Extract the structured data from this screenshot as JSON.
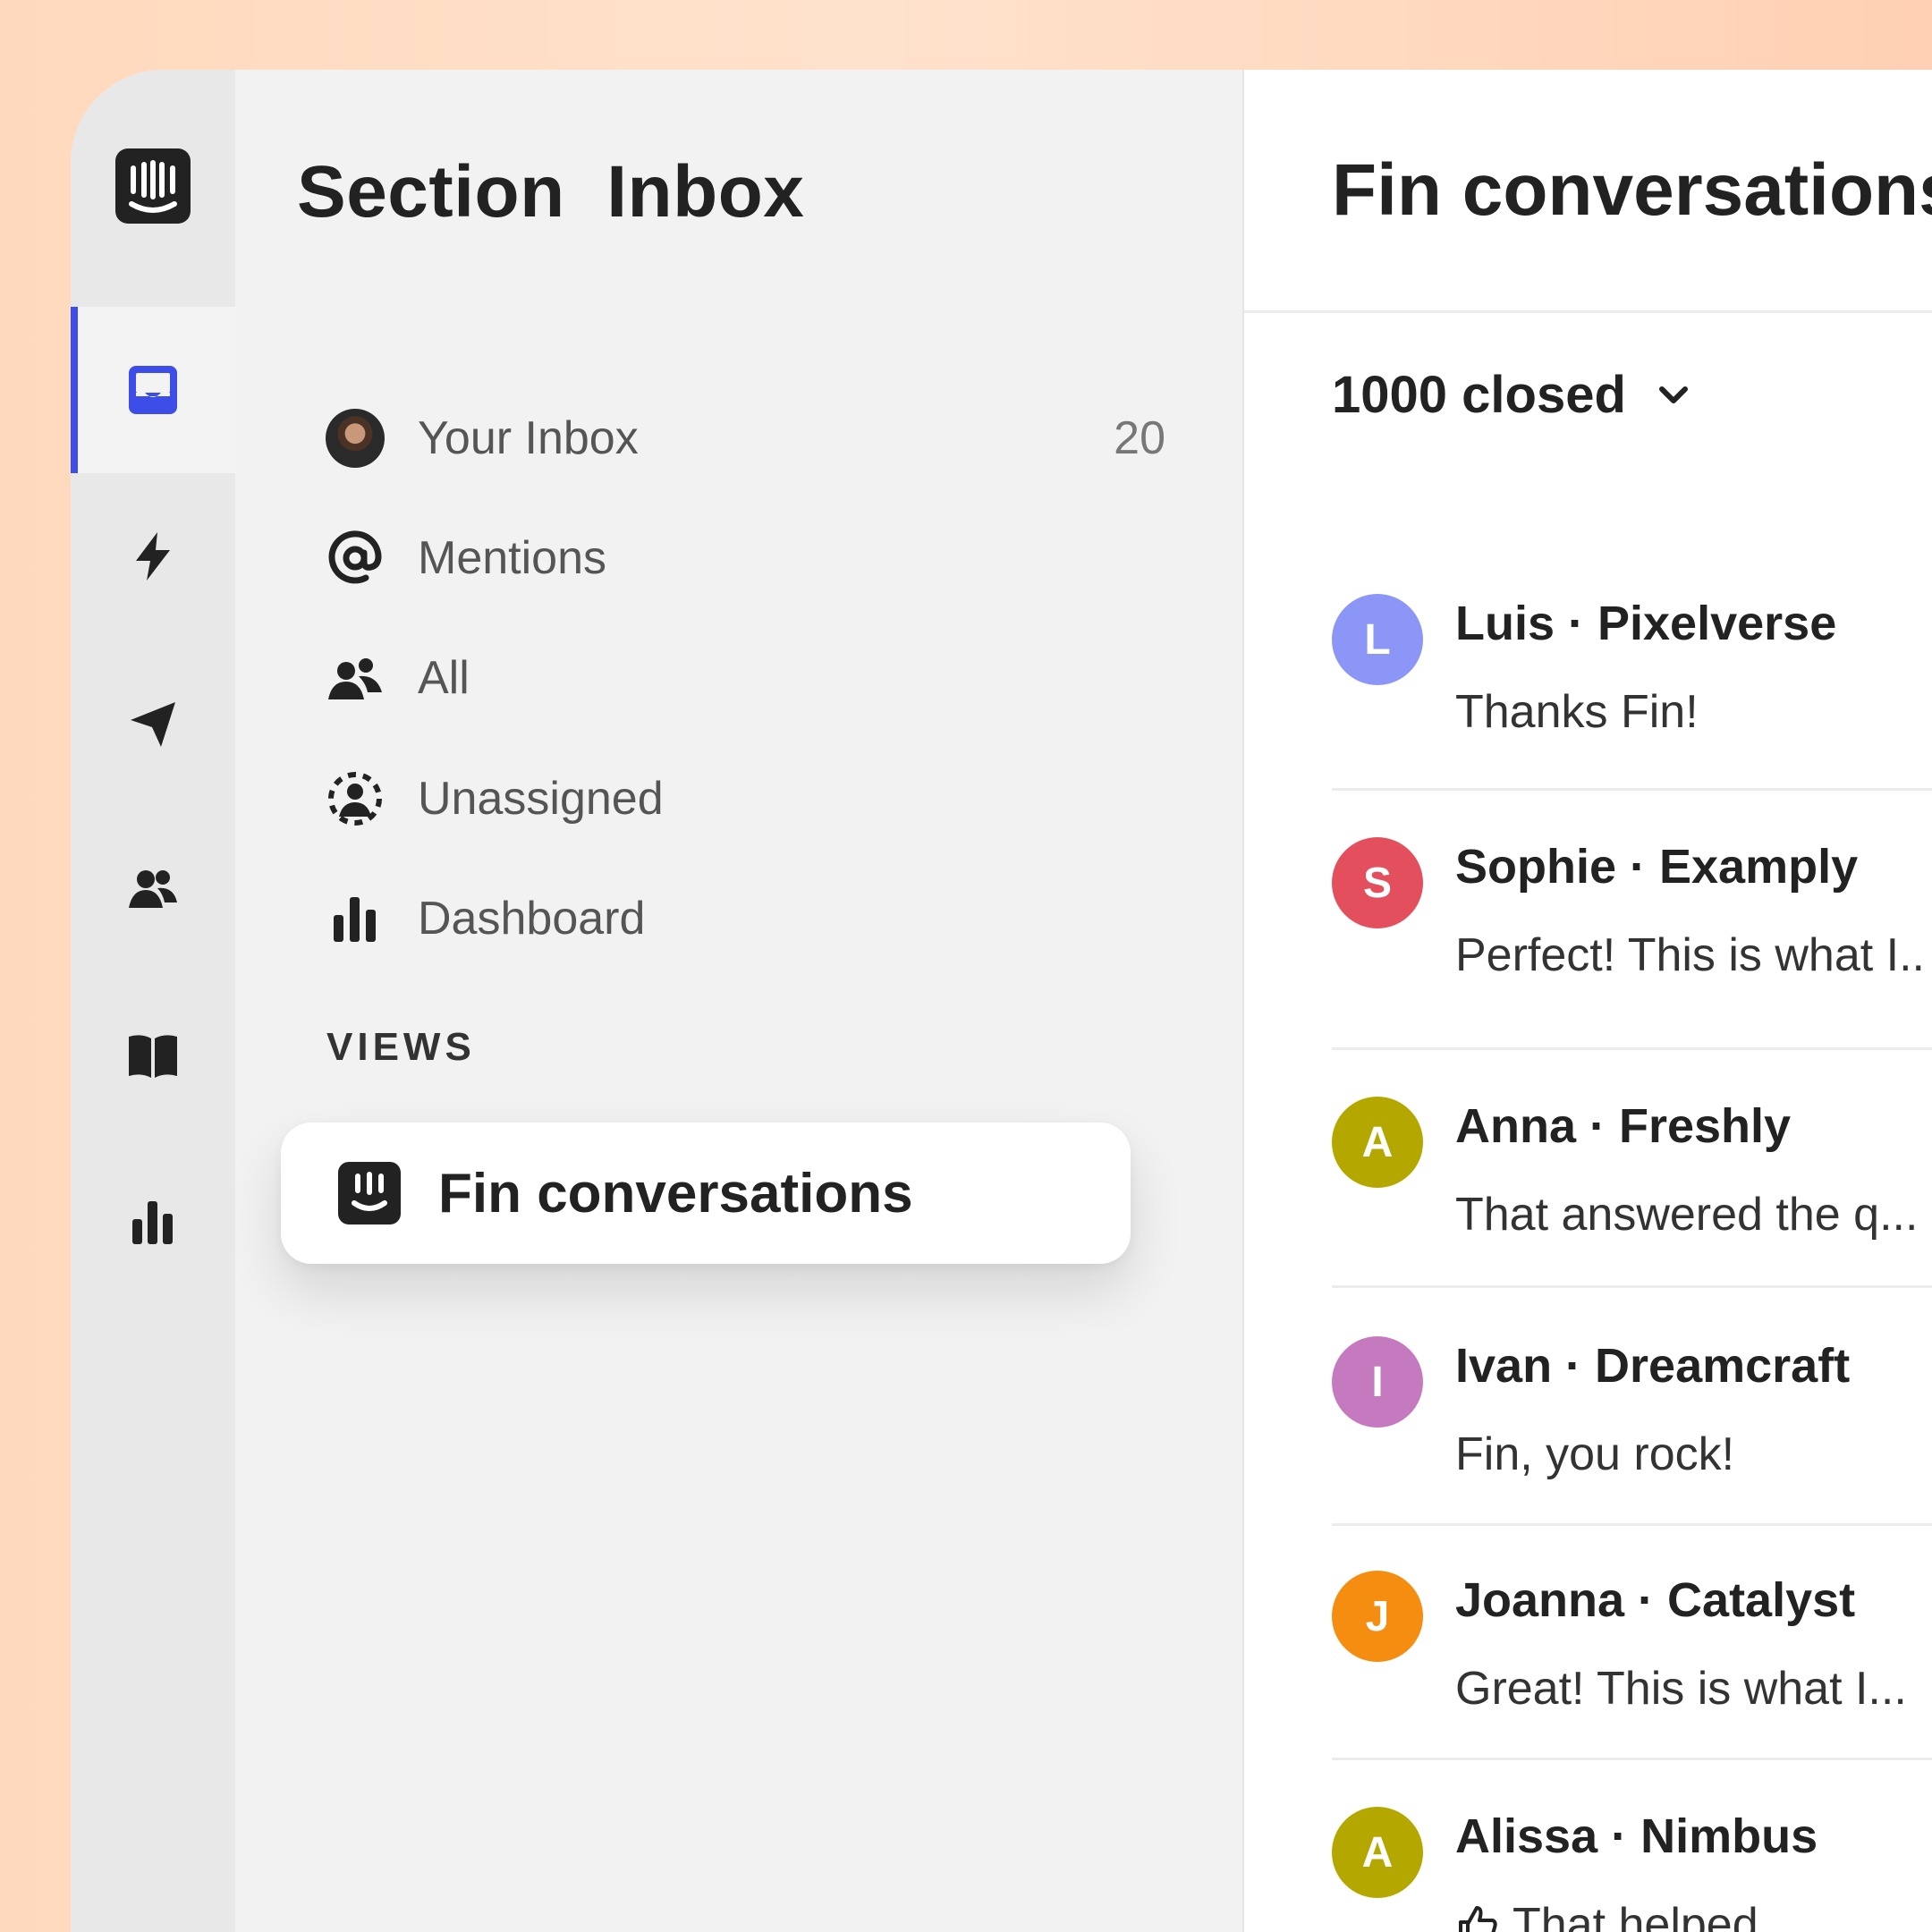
{
  "colors": {
    "accent": "#3d4ee8",
    "avatar_luis": "#8c96f7",
    "avatar_sophie": "#e34f5c",
    "avatar_anna": "#b4a800",
    "avatar_ivan": "#c57ac0",
    "avatar_joanna": "#f58d10",
    "avatar_alissa": "#b4a800"
  },
  "rail": {
    "logo": "intercom-logo",
    "items": [
      {
        "icon": "inbox-icon",
        "active": true
      },
      {
        "icon": "lightning-icon"
      },
      {
        "icon": "paper-plane-icon"
      },
      {
        "icon": "people-icon"
      },
      {
        "icon": "book-icon"
      },
      {
        "icon": "bar-chart-icon"
      }
    ]
  },
  "sidebar": {
    "title": "Section  Inbox",
    "items": [
      {
        "label": "Your Inbox",
        "count": "20",
        "icon": "user-avatar"
      },
      {
        "label": "Mentions",
        "icon": "at-icon"
      },
      {
        "label": "All",
        "icon": "people-icon"
      },
      {
        "label": "Unassigned",
        "icon": "unassigned-icon"
      },
      {
        "label": "Dashboard",
        "icon": "bar-chart-icon"
      }
    ],
    "views_label": "VIEWS",
    "view": {
      "label": "Fin conversations",
      "icon": "fin-icon"
    }
  },
  "panel": {
    "title": "Fin conversations",
    "filter": "1000 closed",
    "conversations": [
      {
        "initial": "L",
        "name": "Luis · Pixelverse",
        "message": "Thanks Fin!"
      },
      {
        "initial": "S",
        "name": "Sophie · Examply",
        "message": "Perfect! This is what I.."
      },
      {
        "initial": "A",
        "name": "Anna · Freshly",
        "message": "That answered the q..."
      },
      {
        "initial": "I",
        "name": "Ivan · Dreamcraft",
        "message": "Fin, you rock!"
      },
      {
        "initial": "J",
        "name": "Joanna · Catalyst",
        "message": "Great! This is what I..."
      },
      {
        "initial": "A",
        "name": "Alissa · Nimbus",
        "message": "That helped",
        "icon": "thumbs-up-icon"
      }
    ]
  }
}
